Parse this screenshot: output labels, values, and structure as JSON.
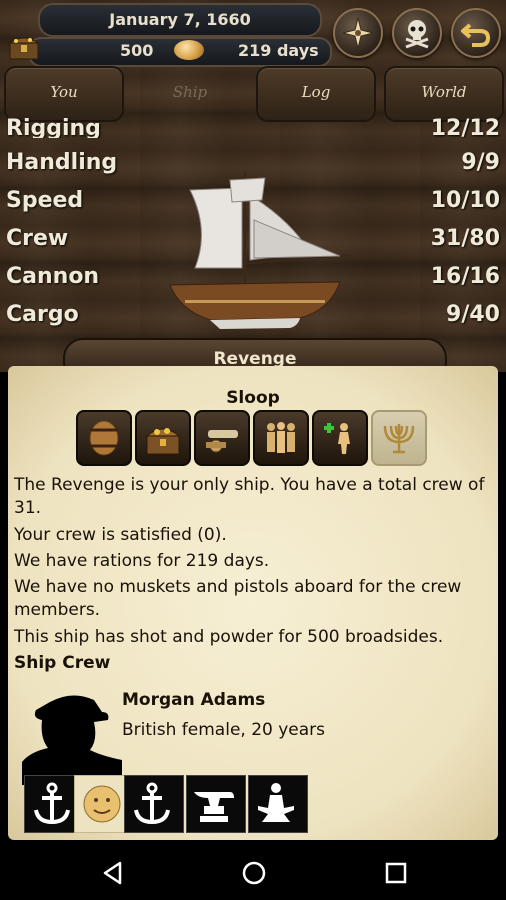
{
  "header": {
    "date": "January 7, 1660",
    "gold": "500",
    "rations": "219 days"
  },
  "tabs": [
    {
      "label": "You"
    },
    {
      "label": "Ship"
    },
    {
      "label": "Log"
    },
    {
      "label": "World"
    }
  ],
  "stats": [
    {
      "label": "Rigging",
      "value": "12/12"
    },
    {
      "label": "Handling",
      "value": "9/9"
    },
    {
      "label": "Speed",
      "value": "10/10"
    },
    {
      "label": "Crew",
      "value": "31/80"
    },
    {
      "label": "Cannon",
      "value": "16/16"
    },
    {
      "label": "Cargo",
      "value": "9/40"
    }
  ],
  "ship": {
    "name": "Revenge",
    "type": "Sloop",
    "hull_fraction": 0.49
  },
  "ship_tabs": [
    "barrel-icon",
    "treasure-chest-icon",
    "cannon-icon",
    "crew-group-icon",
    "add-crew-icon",
    "menorah-icon"
  ],
  "description": [
    "The Revenge is your only ship. You have a total crew of 31.",
    "Your crew is satisfied (0).",
    "We have rations for 219 days.",
    "We have no muskets and pistols aboard for the crew members.",
    "This ship has shot and powder for 500 broadsides."
  ],
  "crew": {
    "title": "Ship Crew",
    "member": {
      "name": "Morgan Adams",
      "desc": "British female, 20 years"
    }
  },
  "colors": {
    "wood": "#3a2a1c",
    "parchment": "#f2e9cb",
    "health_good": "#2e8a2e",
    "health_bad": "#c01818"
  }
}
